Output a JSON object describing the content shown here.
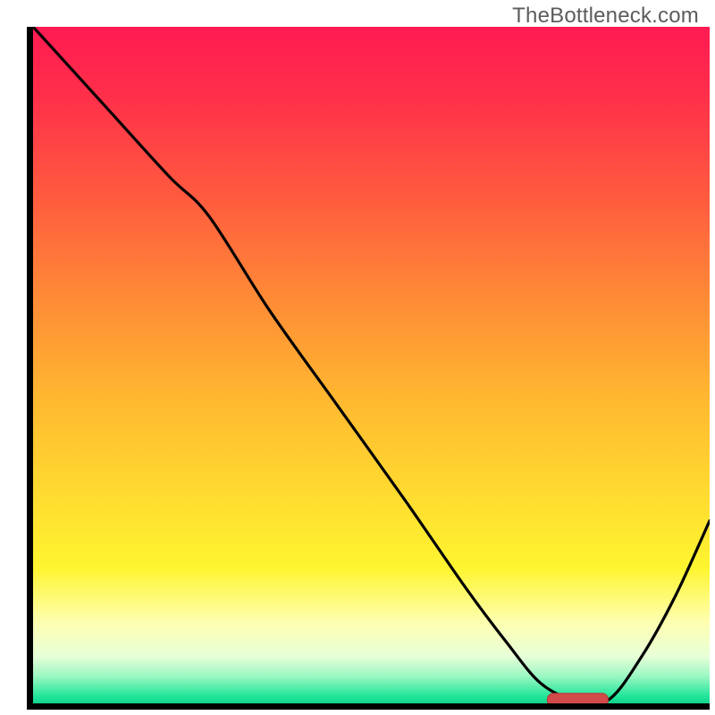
{
  "watermark": "TheBottleneck.com",
  "colors": {
    "axis": "#000000",
    "curve": "#000000",
    "marker_fill": "#d24a4a",
    "marker_stroke": "#b53a3a",
    "watermark": "#5c5c5c"
  },
  "chart_data": {
    "type": "line",
    "x": [
      0.0,
      0.1,
      0.2,
      0.26,
      0.35,
      0.45,
      0.55,
      0.64,
      0.7,
      0.75,
      0.8,
      0.85,
      0.9,
      0.95,
      1.0
    ],
    "values": [
      1.0,
      0.89,
      0.78,
      0.72,
      0.58,
      0.44,
      0.3,
      0.17,
      0.09,
      0.03,
      0.005,
      0.005,
      0.07,
      0.16,
      0.27
    ],
    "xlim": [
      0,
      1
    ],
    "ylim": [
      0,
      1
    ],
    "title": "",
    "xlabel": "",
    "ylabel": "",
    "marker": {
      "x_center": 0.805,
      "y": 0.005,
      "half_width": 0.045,
      "shape": "rounded-bar"
    },
    "background": "vertical-gradient red→orange→yellow→green"
  }
}
